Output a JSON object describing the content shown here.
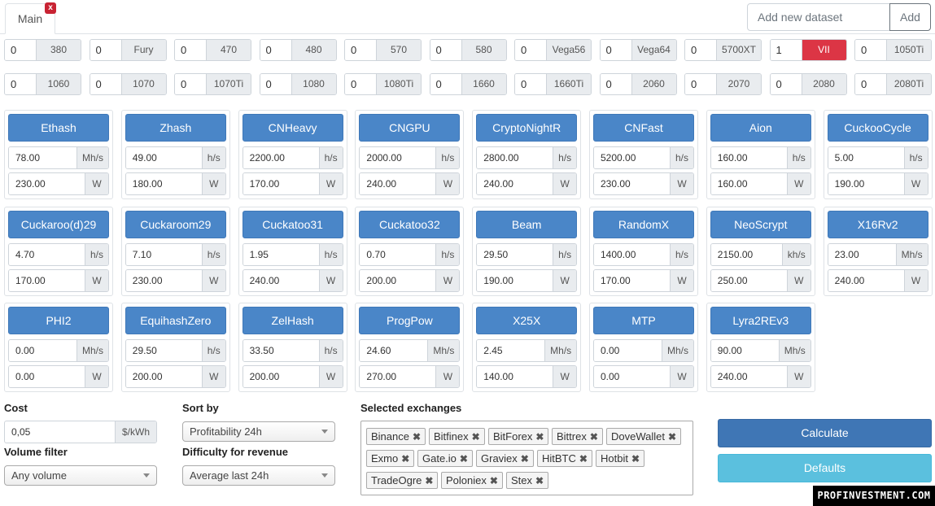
{
  "tabs": [
    {
      "label": "Main",
      "close_glyph": "x"
    }
  ],
  "dataset": {
    "placeholder": "Add new dataset",
    "add_label": "Add"
  },
  "gpus": [
    {
      "count": "0",
      "name": "380"
    },
    {
      "count": "0",
      "name": "Fury"
    },
    {
      "count": "0",
      "name": "470"
    },
    {
      "count": "0",
      "name": "480"
    },
    {
      "count": "0",
      "name": "570"
    },
    {
      "count": "0",
      "name": "580"
    },
    {
      "count": "0",
      "name": "Vega56"
    },
    {
      "count": "0",
      "name": "Vega64"
    },
    {
      "count": "0",
      "name": "5700XT"
    },
    {
      "count": "1",
      "name": "VII",
      "active": true
    },
    {
      "count": "0",
      "name": "1050Ti"
    },
    {
      "count": "0",
      "name": "1060"
    },
    {
      "count": "0",
      "name": "1070"
    },
    {
      "count": "0",
      "name": "1070Ti"
    },
    {
      "count": "0",
      "name": "1080"
    },
    {
      "count": "0",
      "name": "1080Ti"
    },
    {
      "count": "0",
      "name": "1660"
    },
    {
      "count": "0",
      "name": "1660Ti"
    },
    {
      "count": "0",
      "name": "2060"
    },
    {
      "count": "0",
      "name": "2070"
    },
    {
      "count": "0",
      "name": "2080"
    },
    {
      "count": "0",
      "name": "2080Ti"
    }
  ],
  "algorithms": [
    {
      "name": "Ethash",
      "hashrate": "78.00",
      "hr_unit": "Mh/s",
      "power": "230.00",
      "p_unit": "W"
    },
    {
      "name": "Zhash",
      "hashrate": "49.00",
      "hr_unit": "h/s",
      "power": "180.00",
      "p_unit": "W"
    },
    {
      "name": "CNHeavy",
      "hashrate": "2200.00",
      "hr_unit": "h/s",
      "power": "170.00",
      "p_unit": "W"
    },
    {
      "name": "CNGPU",
      "hashrate": "2000.00",
      "hr_unit": "h/s",
      "power": "240.00",
      "p_unit": "W"
    },
    {
      "name": "CryptoNightR",
      "hashrate": "2800.00",
      "hr_unit": "h/s",
      "power": "240.00",
      "p_unit": "W"
    },
    {
      "name": "CNFast",
      "hashrate": "5200.00",
      "hr_unit": "h/s",
      "power": "230.00",
      "p_unit": "W"
    },
    {
      "name": "Aion",
      "hashrate": "160.00",
      "hr_unit": "h/s",
      "power": "160.00",
      "p_unit": "W"
    },
    {
      "name": "CuckooCycle",
      "hashrate": "5.00",
      "hr_unit": "h/s",
      "power": "190.00",
      "p_unit": "W"
    },
    {
      "name": "Cuckaroo(d)29",
      "hashrate": "4.70",
      "hr_unit": "h/s",
      "power": "170.00",
      "p_unit": "W"
    },
    {
      "name": "Cuckaroom29",
      "hashrate": "7.10",
      "hr_unit": "h/s",
      "power": "230.00",
      "p_unit": "W"
    },
    {
      "name": "Cuckatoo31",
      "hashrate": "1.95",
      "hr_unit": "h/s",
      "power": "240.00",
      "p_unit": "W"
    },
    {
      "name": "Cuckatoo32",
      "hashrate": "0.70",
      "hr_unit": "h/s",
      "power": "200.00",
      "p_unit": "W"
    },
    {
      "name": "Beam",
      "hashrate": "29.50",
      "hr_unit": "h/s",
      "power": "190.00",
      "p_unit": "W"
    },
    {
      "name": "RandomX",
      "hashrate": "1400.00",
      "hr_unit": "h/s",
      "power": "170.00",
      "p_unit": "W"
    },
    {
      "name": "NeoScrypt",
      "hashrate": "2150.00",
      "hr_unit": "kh/s",
      "power": "250.00",
      "p_unit": "W"
    },
    {
      "name": "X16Rv2",
      "hashrate": "23.00",
      "hr_unit": "Mh/s",
      "power": "240.00",
      "p_unit": "W"
    },
    {
      "name": "PHI2",
      "hashrate": "0.00",
      "hr_unit": "Mh/s",
      "power": "0.00",
      "p_unit": "W"
    },
    {
      "name": "EquihashZero",
      "hashrate": "29.50",
      "hr_unit": "h/s",
      "power": "200.00",
      "p_unit": "W"
    },
    {
      "name": "ZelHash",
      "hashrate": "33.50",
      "hr_unit": "h/s",
      "power": "200.00",
      "p_unit": "W"
    },
    {
      "name": "ProgPow",
      "hashrate": "24.60",
      "hr_unit": "Mh/s",
      "power": "270.00",
      "p_unit": "W"
    },
    {
      "name": "X25X",
      "hashrate": "2.45",
      "hr_unit": "Mh/s",
      "power": "140.00",
      "p_unit": "W"
    },
    {
      "name": "MTP",
      "hashrate": "0.00",
      "hr_unit": "Mh/s",
      "power": "0.00",
      "p_unit": "W"
    },
    {
      "name": "Lyra2REv3",
      "hashrate": "90.00",
      "hr_unit": "Mh/s",
      "power": "240.00",
      "p_unit": "W"
    }
  ],
  "cost": {
    "label": "Cost",
    "value": "0,05",
    "unit": "$/kWh"
  },
  "volume_filter": {
    "label": "Volume filter",
    "selected": "Any volume"
  },
  "sort_by": {
    "label": "Sort by",
    "selected": "Profitability 24h"
  },
  "difficulty": {
    "label": "Difficulty for revenue",
    "selected": "Average last 24h"
  },
  "exchanges": {
    "label": "Selected exchanges",
    "remove_glyph": "✖",
    "items": [
      "Binance",
      "Bitfinex",
      "BitForex",
      "Bittrex",
      "DoveWallet",
      "Exmo",
      "Gate.io",
      "Graviex",
      "HitBTC",
      "Hotbit",
      "TradeOgre",
      "Poloniex",
      "Stex"
    ]
  },
  "actions": {
    "calculate": "Calculate",
    "defaults": "Defaults"
  },
  "watermark": "PROFINVESTMENT.COM",
  "colors": {
    "primary": "#4a86c8",
    "danger": "#dc3545",
    "info": "#5bc0de"
  }
}
